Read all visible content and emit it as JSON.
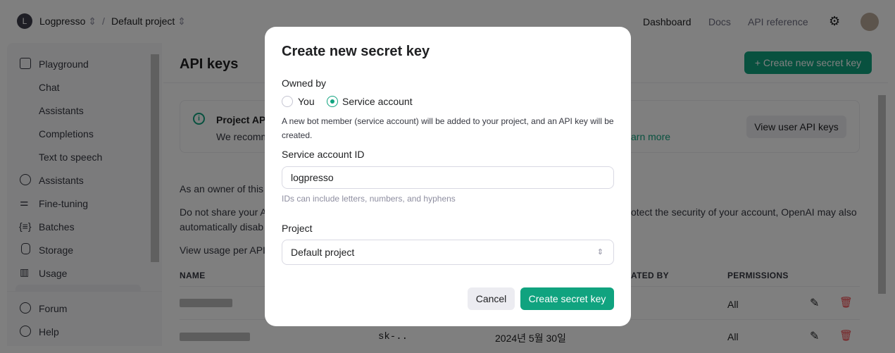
{
  "header": {
    "org_initial": "L",
    "org": "Logpresso",
    "separator": "/",
    "project": "Default project",
    "nav": [
      "Dashboard",
      "Docs",
      "API reference"
    ]
  },
  "sidebar": {
    "items": [
      {
        "label": "Playground",
        "icon": "terminal-icon"
      },
      {
        "label": "Chat"
      },
      {
        "label": "Assistants"
      },
      {
        "label": "Completions"
      },
      {
        "label": "Text to speech"
      },
      {
        "label": "Assistants",
        "icon": "robot-icon"
      },
      {
        "label": "Fine-tuning",
        "icon": "sliders-icon"
      },
      {
        "label": "Batches",
        "icon": "braces-icon"
      },
      {
        "label": "Storage",
        "icon": "database-icon"
      },
      {
        "label": "Usage",
        "icon": "bar-chart-icon"
      }
    ],
    "footer": [
      {
        "label": "Forum",
        "icon": "chat-bubble-icon"
      },
      {
        "label": "Help",
        "icon": "help-circle-icon"
      }
    ]
  },
  "main": {
    "title": "API keys",
    "create_button": "+ Create new secret key",
    "info_title": "Project API",
    "info_text": "We recomm",
    "learn_more": "arn more",
    "view_user_keys": "View user API keys",
    "p1": "As an owner of this p",
    "p2a": "Do not share your A",
    "p2b": "otect the security of your account, OpenAI may also",
    "p2c": "automatically disab",
    "p3": "View usage per API",
    "columns": [
      "NAME",
      "ATED BY",
      "PERMISSIONS"
    ],
    "rows": [
      {
        "key": "",
        "created": "",
        "permissions": "All"
      },
      {
        "key": "sk-..",
        "created": "2024년 5월 30일",
        "permissions": "All"
      }
    ]
  },
  "modal": {
    "title": "Create new secret key",
    "owned_by": "Owned by",
    "options": [
      "You",
      "Service account"
    ],
    "selected": "Service account",
    "desc": "A new bot member (service account) will be added to your project, and an API key will be created.",
    "id_label": "Service account ID",
    "id_value": "logpresso",
    "id_hint": "IDs can include letters, numbers, and hyphens",
    "project_label": "Project",
    "project_value": "Default project",
    "cancel": "Cancel",
    "submit": "Create secret key"
  },
  "colors": {
    "accent": "#10a37f",
    "danger": "#ef4146"
  }
}
